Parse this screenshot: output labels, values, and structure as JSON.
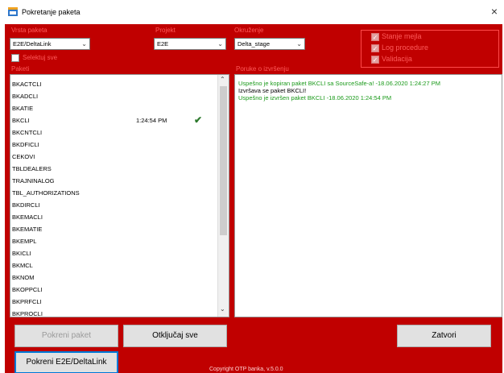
{
  "window": {
    "title": "Pokretanje paketa",
    "close_glyph": "×",
    "app_icon": "app-window-icon"
  },
  "form": {
    "vrsta_paketa": {
      "label": "Vrsta paketa",
      "value": "E2E/DeltaLink"
    },
    "projekt": {
      "label": "Projekt",
      "value": "E2E"
    },
    "okruzenje": {
      "label": "Okruženje",
      "value": "Delta_stage"
    },
    "selektuj_sve": {
      "label": "Selektuj sve",
      "checked": false
    }
  },
  "options": [
    {
      "label": "Stanje mejla",
      "checked": true,
      "enabled": false
    },
    {
      "label": "Log procedure",
      "checked": true,
      "enabled": false
    },
    {
      "label": "Validacija",
      "checked": true,
      "enabled": false
    }
  ],
  "paketi": {
    "label": "Paketi",
    "items": [
      {
        "name": "BKACTCLI",
        "time": "",
        "done": false
      },
      {
        "name": "BKADCLI",
        "time": "",
        "done": false
      },
      {
        "name": "BKATIE",
        "time": "",
        "done": false
      },
      {
        "name": "BKCLI",
        "time": "1:24:54 PM",
        "done": true
      },
      {
        "name": "BKCNTCLI",
        "time": "",
        "done": false
      },
      {
        "name": "BKDFICLI",
        "time": "",
        "done": false
      },
      {
        "name": "CEKOVI",
        "time": "",
        "done": false
      },
      {
        "name": "TBLDEALERS",
        "time": "",
        "done": false
      },
      {
        "name": "TRAJNINALOG",
        "time": "",
        "done": false
      },
      {
        "name": "TBL_AUTHORIZATIONS",
        "time": "",
        "done": false
      },
      {
        "name": "BKDIRCLI",
        "time": "",
        "done": false
      },
      {
        "name": "BKEMACLI",
        "time": "",
        "done": false
      },
      {
        "name": "BKEMATIE",
        "time": "",
        "done": false
      },
      {
        "name": "BKEMPL",
        "time": "",
        "done": false
      },
      {
        "name": "BKICLI",
        "time": "",
        "done": false
      },
      {
        "name": "BKMCL",
        "time": "",
        "done": false
      },
      {
        "name": "BKNOM",
        "time": "",
        "done": false
      },
      {
        "name": "BKOPPCLI",
        "time": "",
        "done": false
      },
      {
        "name": "BKPRFCLI",
        "time": "",
        "done": false
      },
      {
        "name": "BKPROCLI",
        "time": "",
        "done": false
      }
    ],
    "done_glyph": "✔"
  },
  "poruke": {
    "label": "Poruke o izvršenju",
    "messages": [
      {
        "text": "Uspešno je kopiran paket BKCLI sa SourceSafe-a! -18.06.2020 1:24:27 PM",
        "color": "#1a9a1a"
      },
      {
        "text": "Izvršava se paket BKCLI!",
        "color": "#000000"
      },
      {
        "text": "Uspešno je izvršen paket BKCLI -18.06.2020 1:24:54 PM",
        "color": "#1a9a1a"
      }
    ]
  },
  "buttons": {
    "pokreni_paket": "Pokreni paket",
    "otkljucaj_sve": "Otključaj sve",
    "zatvori": "Zatvori",
    "pokreni_e2e": "Pokreni E2E/DeltaLink"
  },
  "footer": "Copyright OTP banka, v.5.0.0",
  "colors": {
    "accent": "#c00000",
    "label": "#ff5a5a",
    "success": "#1a9a1a",
    "focus": "#0078d7"
  }
}
